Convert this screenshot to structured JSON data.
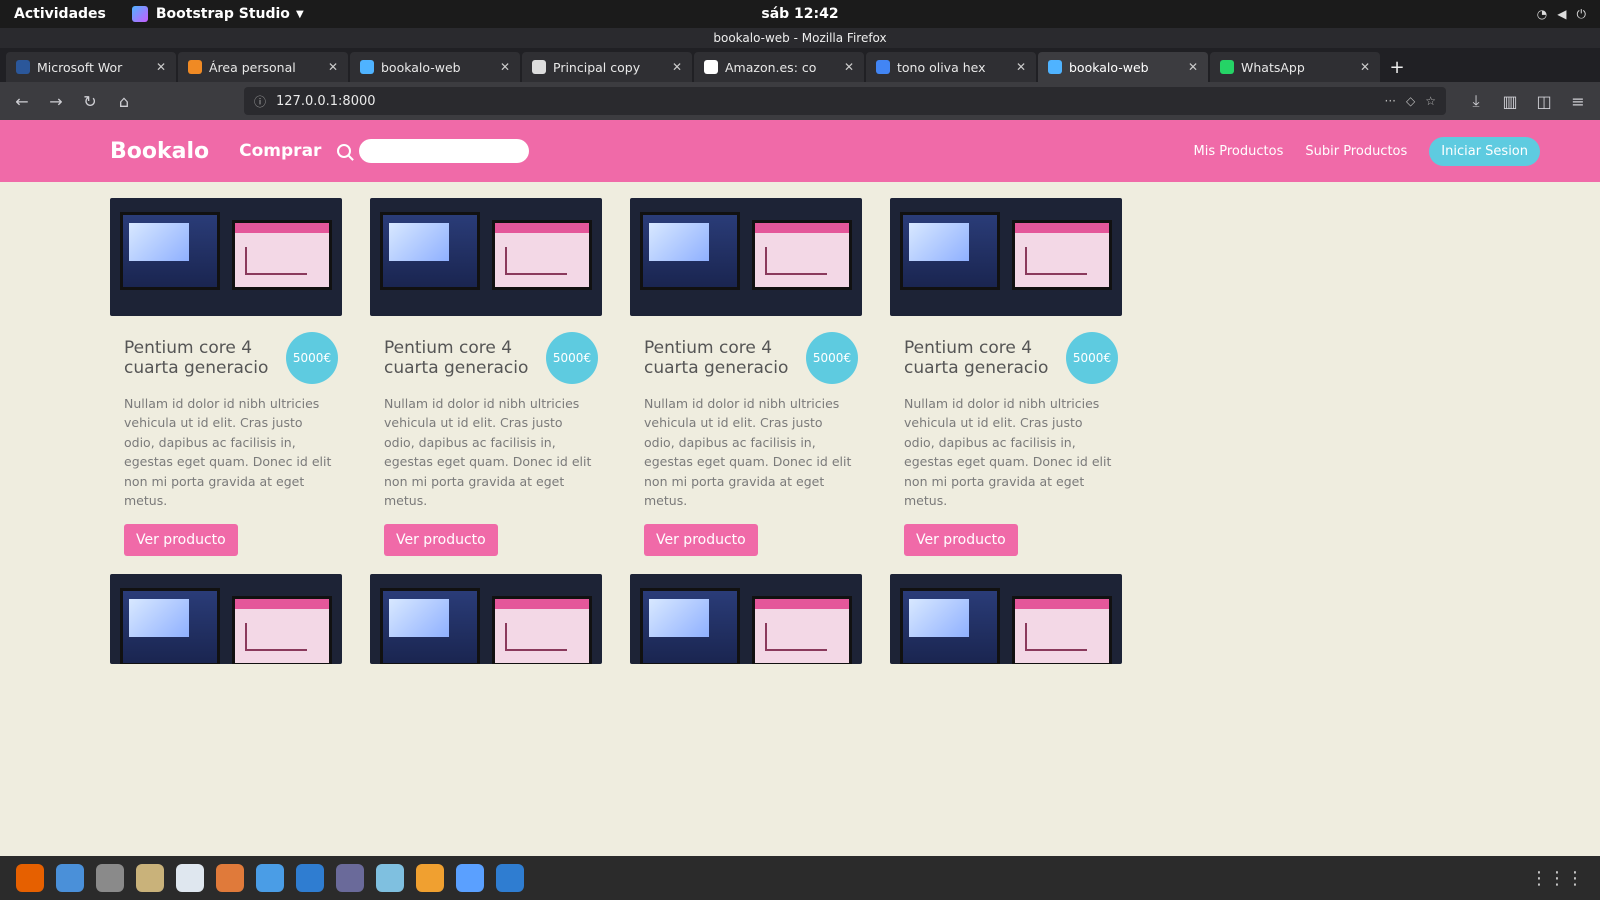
{
  "system": {
    "activities": "Actividades",
    "app_name": "Bootstrap Studio",
    "clock": "sáb 12:42"
  },
  "browser": {
    "window_title": "bookalo-web - Mozilla Firefox",
    "tabs": [
      {
        "label": "Microsoft Wor",
        "icon_color": "#2b579a"
      },
      {
        "label": "Área personal",
        "icon_color": "#f08a24"
      },
      {
        "label": "bookalo-web",
        "icon_color": "#4fb3ff"
      },
      {
        "label": "Principal copy",
        "icon_color": "#dddddd"
      },
      {
        "label": "Amazon.es: co",
        "icon_color": "#ffffff"
      },
      {
        "label": "tono oliva hex",
        "icon_color": "#4285f4"
      },
      {
        "label": "bookalo-web",
        "icon_color": "#4fb3ff",
        "active": true
      },
      {
        "label": "WhatsApp",
        "icon_color": "#25d366"
      }
    ],
    "url": "127.0.0.1:8000"
  },
  "site": {
    "brand": "Bookalo",
    "nav_comprar": "Comprar",
    "nav_mis_productos": "Mis Productos",
    "nav_subir_productos": "Subir Productos",
    "login_button": "Iniciar Sesion",
    "colors": {
      "primary": "#f06aa8",
      "accent": "#5ecbe0",
      "background": "#efeddf"
    }
  },
  "products": [
    {
      "title": "Pentium core 4 cuarta generacio",
      "price": "5000€",
      "description": "Nullam id dolor id nibh ultricies vehicula ut id elit. Cras justo odio, dapibus ac facilisis in, egestas eget quam. Donec id elit non mi porta gravida at eget metus.",
      "button": "Ver producto"
    },
    {
      "title": "Pentium core 4 cuarta generacio",
      "price": "5000€",
      "description": "Nullam id dolor id nibh ultricies vehicula ut id elit. Cras justo odio, dapibus ac facilisis in, egestas eget quam. Donec id elit non mi porta gravida at eget metus.",
      "button": "Ver producto"
    },
    {
      "title": "Pentium core 4 cuarta generacio",
      "price": "5000€",
      "description": "Nullam id dolor id nibh ultricies vehicula ut id elit. Cras justo odio, dapibus ac facilisis in, egestas eget quam. Donec id elit non mi porta gravida at eget metus.",
      "button": "Ver producto"
    },
    {
      "title": "Pentium core 4 cuarta generacio",
      "price": "5000€",
      "description": "Nullam id dolor id nibh ultricies vehicula ut id elit. Cras justo odio, dapibus ac facilisis in, egestas eget quam. Donec id elit non mi porta gravida at eget metus.",
      "button": "Ver producto"
    }
  ]
}
